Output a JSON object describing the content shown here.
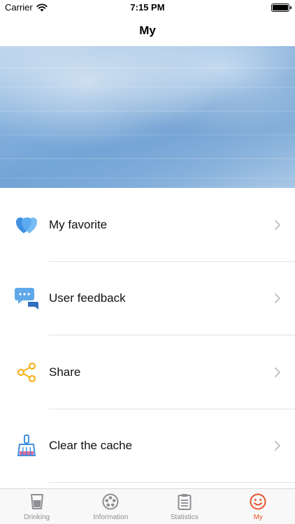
{
  "status_bar": {
    "carrier": "Carrier",
    "time": "7:15 PM"
  },
  "nav": {
    "title": "My"
  },
  "hero": {
    "image": "water-surface-photo"
  },
  "menu": {
    "items": [
      {
        "label": "My favorite",
        "icon": "heart-icon",
        "color": "#3f8fe0"
      },
      {
        "label": "User feedback",
        "icon": "chat-bubble-icon",
        "color": "#3f8fe0"
      },
      {
        "label": "Share",
        "icon": "share-icon",
        "color": "#f2b31c"
      },
      {
        "label": "Clear the cache",
        "icon": "broom-icon",
        "color": "#3f8fe0"
      }
    ]
  },
  "tab_bar": {
    "active": "My",
    "active_color": "#e8542a",
    "tabs": [
      {
        "label": "Drinking",
        "icon": "cup-icon"
      },
      {
        "label": "Information",
        "icon": "film-reel-icon"
      },
      {
        "label": "Statistics",
        "icon": "clipboard-list-icon"
      },
      {
        "label": "My",
        "icon": "smiley-icon"
      }
    ]
  }
}
